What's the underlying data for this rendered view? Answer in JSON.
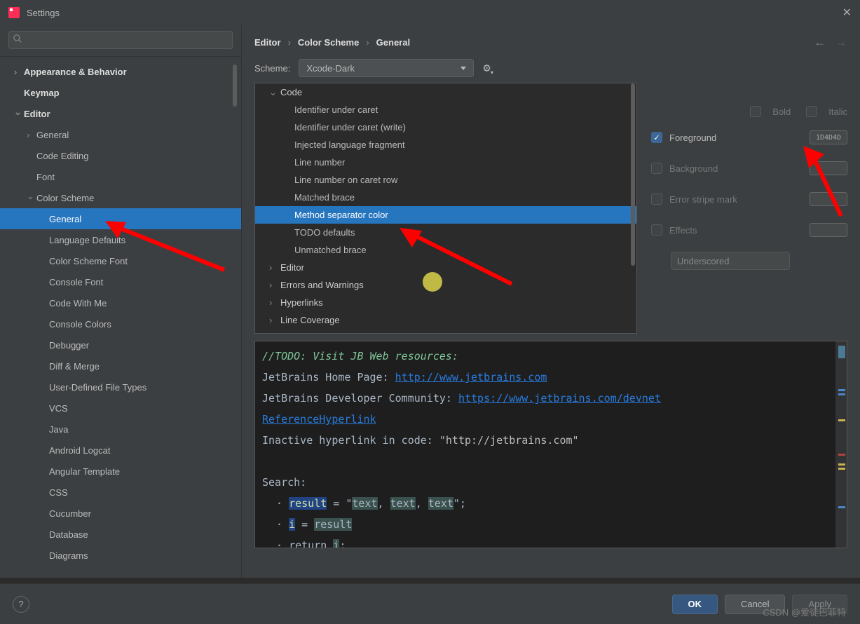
{
  "title": "Settings",
  "breadcrumbs": [
    "Editor",
    "Color Scheme",
    "General"
  ],
  "scheme": {
    "label": "Scheme:",
    "value": "Xcode-Dark"
  },
  "navTree": [
    {
      "t": "Appearance & Behavior",
      "l": 0,
      "b": 1,
      "c": ">"
    },
    {
      "t": "Keymap",
      "l": 0,
      "b": 1,
      "c": ""
    },
    {
      "t": "Editor",
      "l": 0,
      "b": 1,
      "c": "v"
    },
    {
      "t": "General",
      "l": 1,
      "b": 0,
      "c": ">"
    },
    {
      "t": "Code Editing",
      "l": 1,
      "b": 0,
      "c": ""
    },
    {
      "t": "Font",
      "l": 1,
      "b": 0,
      "c": ""
    },
    {
      "t": "Color Scheme",
      "l": 1,
      "b": 0,
      "c": "v"
    },
    {
      "t": "General",
      "l": 2,
      "b": 0,
      "c": "",
      "sel": 1
    },
    {
      "t": "Language Defaults",
      "l": 2,
      "b": 0,
      "c": ""
    },
    {
      "t": "Color Scheme Font",
      "l": 2,
      "b": 0,
      "c": ""
    },
    {
      "t": "Console Font",
      "l": 2,
      "b": 0,
      "c": ""
    },
    {
      "t": "Code With Me",
      "l": 2,
      "b": 0,
      "c": ""
    },
    {
      "t": "Console Colors",
      "l": 2,
      "b": 0,
      "c": ""
    },
    {
      "t": "Debugger",
      "l": 2,
      "b": 0,
      "c": ""
    },
    {
      "t": "Diff & Merge",
      "l": 2,
      "b": 0,
      "c": ""
    },
    {
      "t": "User-Defined File Types",
      "l": 2,
      "b": 0,
      "c": ""
    },
    {
      "t": "VCS",
      "l": 2,
      "b": 0,
      "c": ""
    },
    {
      "t": "Java",
      "l": 2,
      "b": 0,
      "c": ""
    },
    {
      "t": "Android Logcat",
      "l": 2,
      "b": 0,
      "c": ""
    },
    {
      "t": "Angular Template",
      "l": 2,
      "b": 0,
      "c": ""
    },
    {
      "t": "CSS",
      "l": 2,
      "b": 0,
      "c": ""
    },
    {
      "t": "Cucumber",
      "l": 2,
      "b": 0,
      "c": ""
    },
    {
      "t": "Database",
      "l": 2,
      "b": 0,
      "c": ""
    },
    {
      "t": "Diagrams",
      "l": 2,
      "b": 0,
      "c": ""
    }
  ],
  "list": [
    {
      "t": "Code",
      "g": 1,
      "c": "v"
    },
    {
      "t": "Identifier under caret",
      "g": 0
    },
    {
      "t": "Identifier under caret (write)",
      "g": 0
    },
    {
      "t": "Injected language fragment",
      "g": 0
    },
    {
      "t": "Line number",
      "g": 0
    },
    {
      "t": "Line number on caret row",
      "g": 0
    },
    {
      "t": "Matched brace",
      "g": 0
    },
    {
      "t": "Method separator color",
      "g": 0,
      "sel": 1
    },
    {
      "t": "TODO defaults",
      "g": 0
    },
    {
      "t": "Unmatched brace",
      "g": 0
    },
    {
      "t": "Editor",
      "g": 1,
      "c": ">"
    },
    {
      "t": "Errors and Warnings",
      "g": 1,
      "c": ">"
    },
    {
      "t": "Hyperlinks",
      "g": 1,
      "c": ">"
    },
    {
      "t": "Line Coverage",
      "g": 1,
      "c": ">"
    }
  ],
  "props": {
    "bold": "Bold",
    "italic": "Italic",
    "foreground": "Foreground",
    "fgVal": "1D4D4D",
    "background": "Background",
    "stripe": "Error stripe mark",
    "effects": "Effects",
    "effectType": "Underscored"
  },
  "preview": {
    "todo": "//TODO: Visit JB Web resources:",
    "l2a": "JetBrains Home Page: ",
    "l2b": "http://www.jetbrains.com",
    "l3a": "JetBrains Developer Community: ",
    "l3b": "https://www.jetbrains.com/devnet",
    "l4": "ReferenceHyperlink",
    "l5a": "Inactive hyperlink in code: \"",
    "l5b": "http://jetbrains.com",
    "l5c": "\"",
    "l7": "Search:",
    "l8a": "result",
    "l8b": " = \"",
    "l8c": "text",
    "l8d": ", ",
    "l8e": "text",
    "l8f": ", ",
    "l8g": "text",
    "l8h": "\";",
    "l9a": "i",
    "l9b": " = ",
    "l9c": "result",
    "l10a": "return ",
    "l10b": "i",
    "l10c": ";"
  },
  "buttons": {
    "ok": "OK",
    "cancel": "Cancel",
    "apply": "Apply"
  },
  "watermark": "CSDN @爱徒巴菲特"
}
